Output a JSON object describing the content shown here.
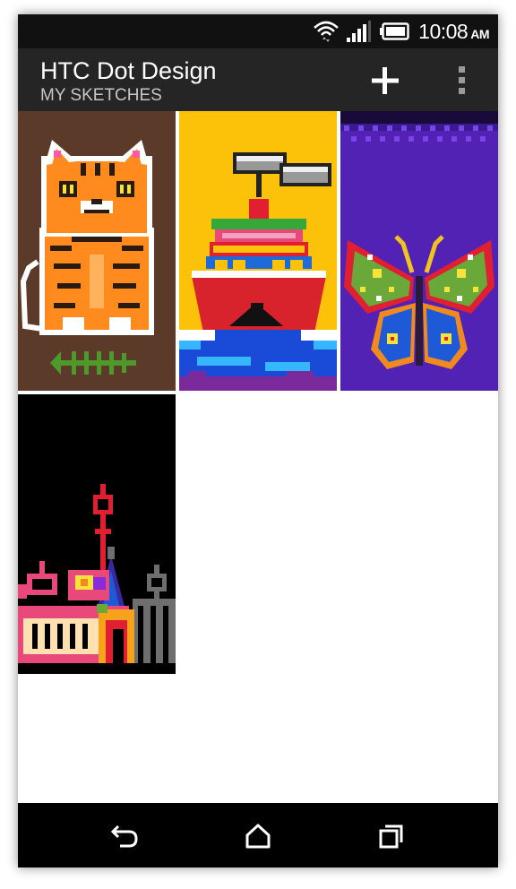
{
  "status_bar": {
    "time": "10:08",
    "ampm": "AM",
    "icons": [
      "wifi-icon",
      "signal-icon",
      "battery-icon"
    ]
  },
  "app_bar": {
    "title": "HTC Dot Design",
    "subtitle": "MY SKETCHES",
    "actions": [
      "add-icon",
      "overflow-menu-icon"
    ]
  },
  "sketches": [
    {
      "subject": "orange tabby cat with fish bones",
      "background": "#5b3a29"
    },
    {
      "subject": "ship on the sea",
      "background": "#fcc20a"
    },
    {
      "subject": "butterfly",
      "background": "#5222b4"
    },
    {
      "subject": "city skyline with towers",
      "background": "#000000"
    }
  ],
  "nav_bar": {
    "buttons": [
      "back-icon",
      "home-icon",
      "recent-apps-icon"
    ]
  }
}
